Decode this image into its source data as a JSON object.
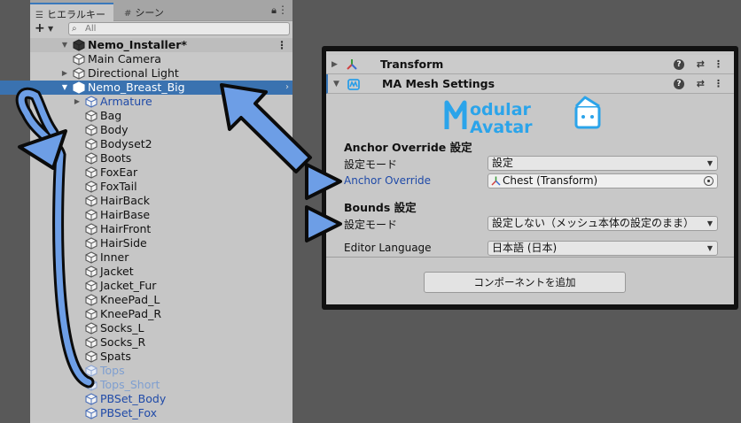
{
  "hierarchy": {
    "tab_label": "ヒエラルキー",
    "scene_tab_label": "シーン",
    "search_placeholder": "All",
    "scene_name": "Nemo_Installer*",
    "items": [
      {
        "label": "Main Camera"
      },
      {
        "label": "Directional Light"
      },
      {
        "label": "Nemo_Breast_Big"
      },
      {
        "label": "Armature"
      },
      {
        "label": "Bag"
      },
      {
        "label": "Body"
      },
      {
        "label": "Bodyset2"
      },
      {
        "label": "Boots"
      },
      {
        "label": "FoxEar"
      },
      {
        "label": "FoxTail"
      },
      {
        "label": "HairBack"
      },
      {
        "label": "HairBase"
      },
      {
        "label": "HairFront"
      },
      {
        "label": "HairSide"
      },
      {
        "label": "Inner"
      },
      {
        "label": "Jacket"
      },
      {
        "label": "Jacket_Fur"
      },
      {
        "label": "KneePad_L"
      },
      {
        "label": "KneePad_R"
      },
      {
        "label": "Socks_L"
      },
      {
        "label": "Socks_R"
      },
      {
        "label": "Spats"
      },
      {
        "label": "Tops"
      },
      {
        "label": "Tops_Short"
      },
      {
        "label": "PBSet_Body"
      },
      {
        "label": "PBSet_Fox"
      }
    ]
  },
  "inspector": {
    "transform_title": "Transform",
    "ma_title": "MA Mesh Settings",
    "logo_line1": "odular",
    "logo_line2": "Avatar",
    "anchor_section": "Anchor Override 設定",
    "anchor_mode_label": "設定モード",
    "anchor_mode_value": "設定",
    "anchor_override_label": "Anchor Override",
    "anchor_override_value": "Chest (Transform)",
    "bounds_section": "Bounds 設定",
    "bounds_mode_label": "設定モード",
    "bounds_mode_value": "設定しない（メッシュ本体の設定のまま）",
    "lang_label": "Editor Language",
    "lang_value": "日本語 (日本)",
    "add_component": "コンポーネントを追加"
  },
  "colors": {
    "selection": "#3a72b0",
    "prefab_text": "#1f4aa8",
    "annotation_fill": "#6d9ee6",
    "annotation_stroke": "#0b0b0b"
  }
}
